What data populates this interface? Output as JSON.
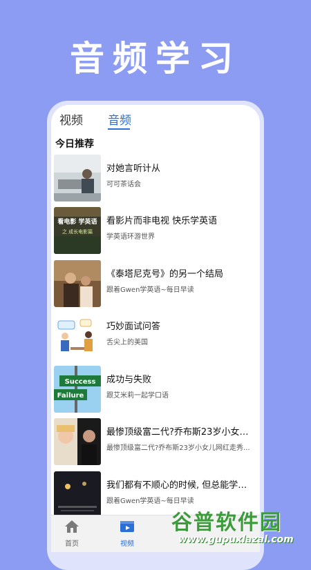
{
  "banner": {
    "title": "音频学习"
  },
  "tabs": [
    {
      "label": "视频",
      "active": false
    },
    {
      "label": "音频",
      "active": true
    }
  ],
  "section": {
    "title": "今日推荐"
  },
  "items": [
    {
      "title": "对她言听计从",
      "subtitle": "可可茶话会"
    },
    {
      "title": "看影片而非电视 快乐学英语",
      "subtitle": "学英语环游世界"
    },
    {
      "title": "《泰塔尼克号》的另一个结局",
      "subtitle": "跟着Gwen学英语~每日早读"
    },
    {
      "title": "巧妙面试问答",
      "subtitle": "舌尖上的美国"
    },
    {
      "title": "成功与失败",
      "subtitle": "跟艾米莉一起学口语"
    },
    {
      "title": "最惨顶级富二代?乔布斯23岁小女儿...",
      "subtitle": "最惨顶级富二代?乔布斯23岁小女儿网红走秀..."
    },
    {
      "title": "我们都有不顺心的时候, 但总能学着...",
      "subtitle": "跟着Gwen学英语~每日早读"
    }
  ],
  "bottom_nav": [
    {
      "label": "首页",
      "icon": "home-icon"
    },
    {
      "label": "视频",
      "icon": "video-icon"
    }
  ],
  "thumb_text": {
    "t2_line1": "看电影 学英语",
    "t2_line2": "之 成长电影篇",
    "t5_line1": "Success",
    "t5_line2": "Failure"
  },
  "watermark": {
    "main": "谷普软件园",
    "url": "www.gupuxlazal.com"
  },
  "colors": {
    "background": "#8c9cf2",
    "accent": "#2a6fd6",
    "watermark_green": "#3c9c3c"
  }
}
